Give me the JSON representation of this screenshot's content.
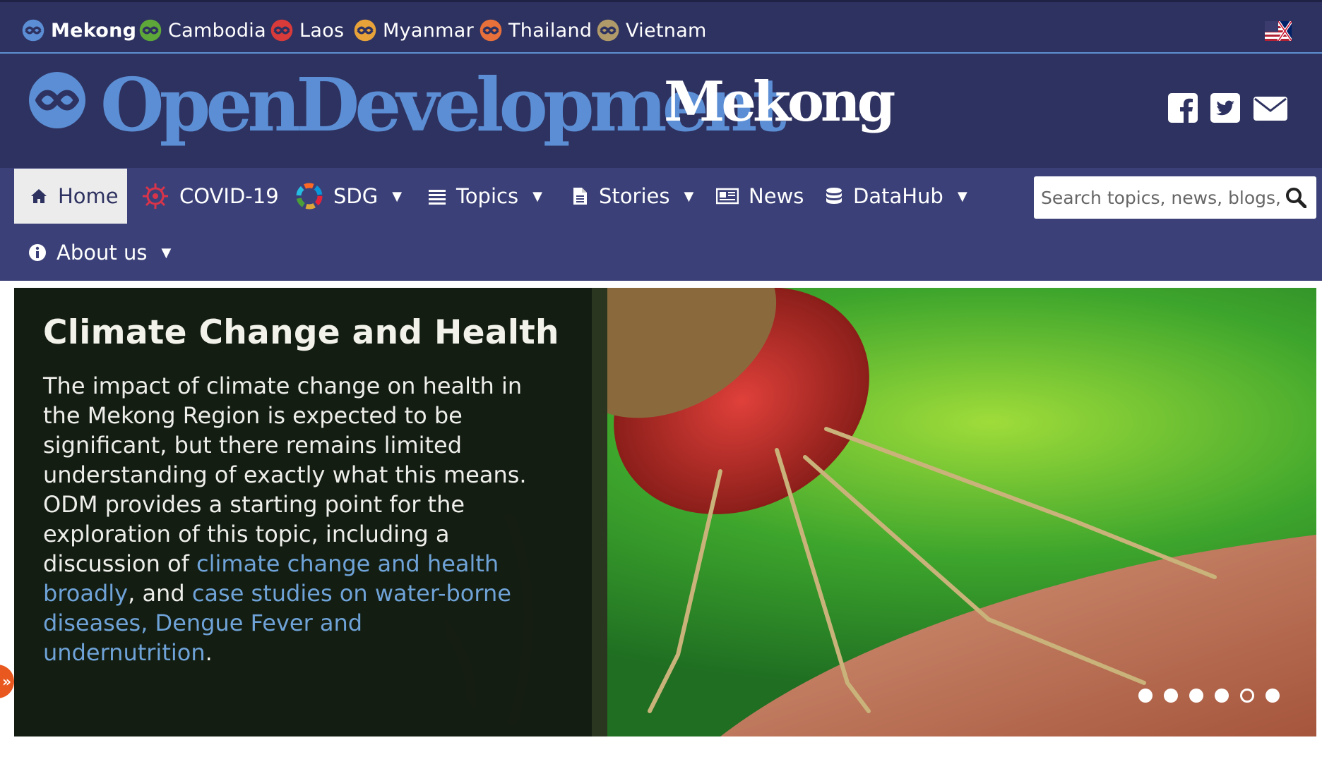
{
  "countries": [
    {
      "label": "Mekong",
      "color": "#5b8ed4"
    },
    {
      "label": "Cambodia",
      "color": "#5ea83a"
    },
    {
      "label": "Laos",
      "color": "#d93a3a"
    },
    {
      "label": "Myanmar",
      "color": "#e8a23a"
    },
    {
      "label": "Thailand",
      "color": "#e8703a"
    },
    {
      "label": "Vietnam",
      "color": "#b09a6a"
    }
  ],
  "language_flag": "uk-us-flag-icon",
  "brand": {
    "name": "OpenDevelopment",
    "region": "Mekong",
    "name_color": "#5b8ed4"
  },
  "social": [
    "facebook-icon",
    "twitter-icon",
    "email-icon"
  ],
  "nav": {
    "home": "Home",
    "covid": "COVID-19",
    "sdg": "SDG",
    "topics": "Topics",
    "stories": "Stories",
    "news": "News",
    "datahub": "DataHub",
    "about": "About us"
  },
  "search": {
    "placeholder": "Search topics, news, blogs, l"
  },
  "hero": {
    "title": "Climate Change and Health",
    "body_1": "The impact of climate change on health in the Mekong Region is expected to be signifi­cant, but there remains limited understand­ing of exactly what this means. ODM pro­vides a starting point for the exploration of this topic, including a discussion of ",
    "link_1": "climate change and health broadly",
    "body_2": ", and ",
    "link_2": "case studies on water-borne diseases, Dengue Fever and undernutrition",
    "body_3": ".",
    "slide_count": 6,
    "active_slide": 5
  },
  "colors": {
    "header_bg": "#2e3260",
    "nav_bg": "#3b4178",
    "accent": "#5b8ed4",
    "side_tab": "#e8581f"
  }
}
